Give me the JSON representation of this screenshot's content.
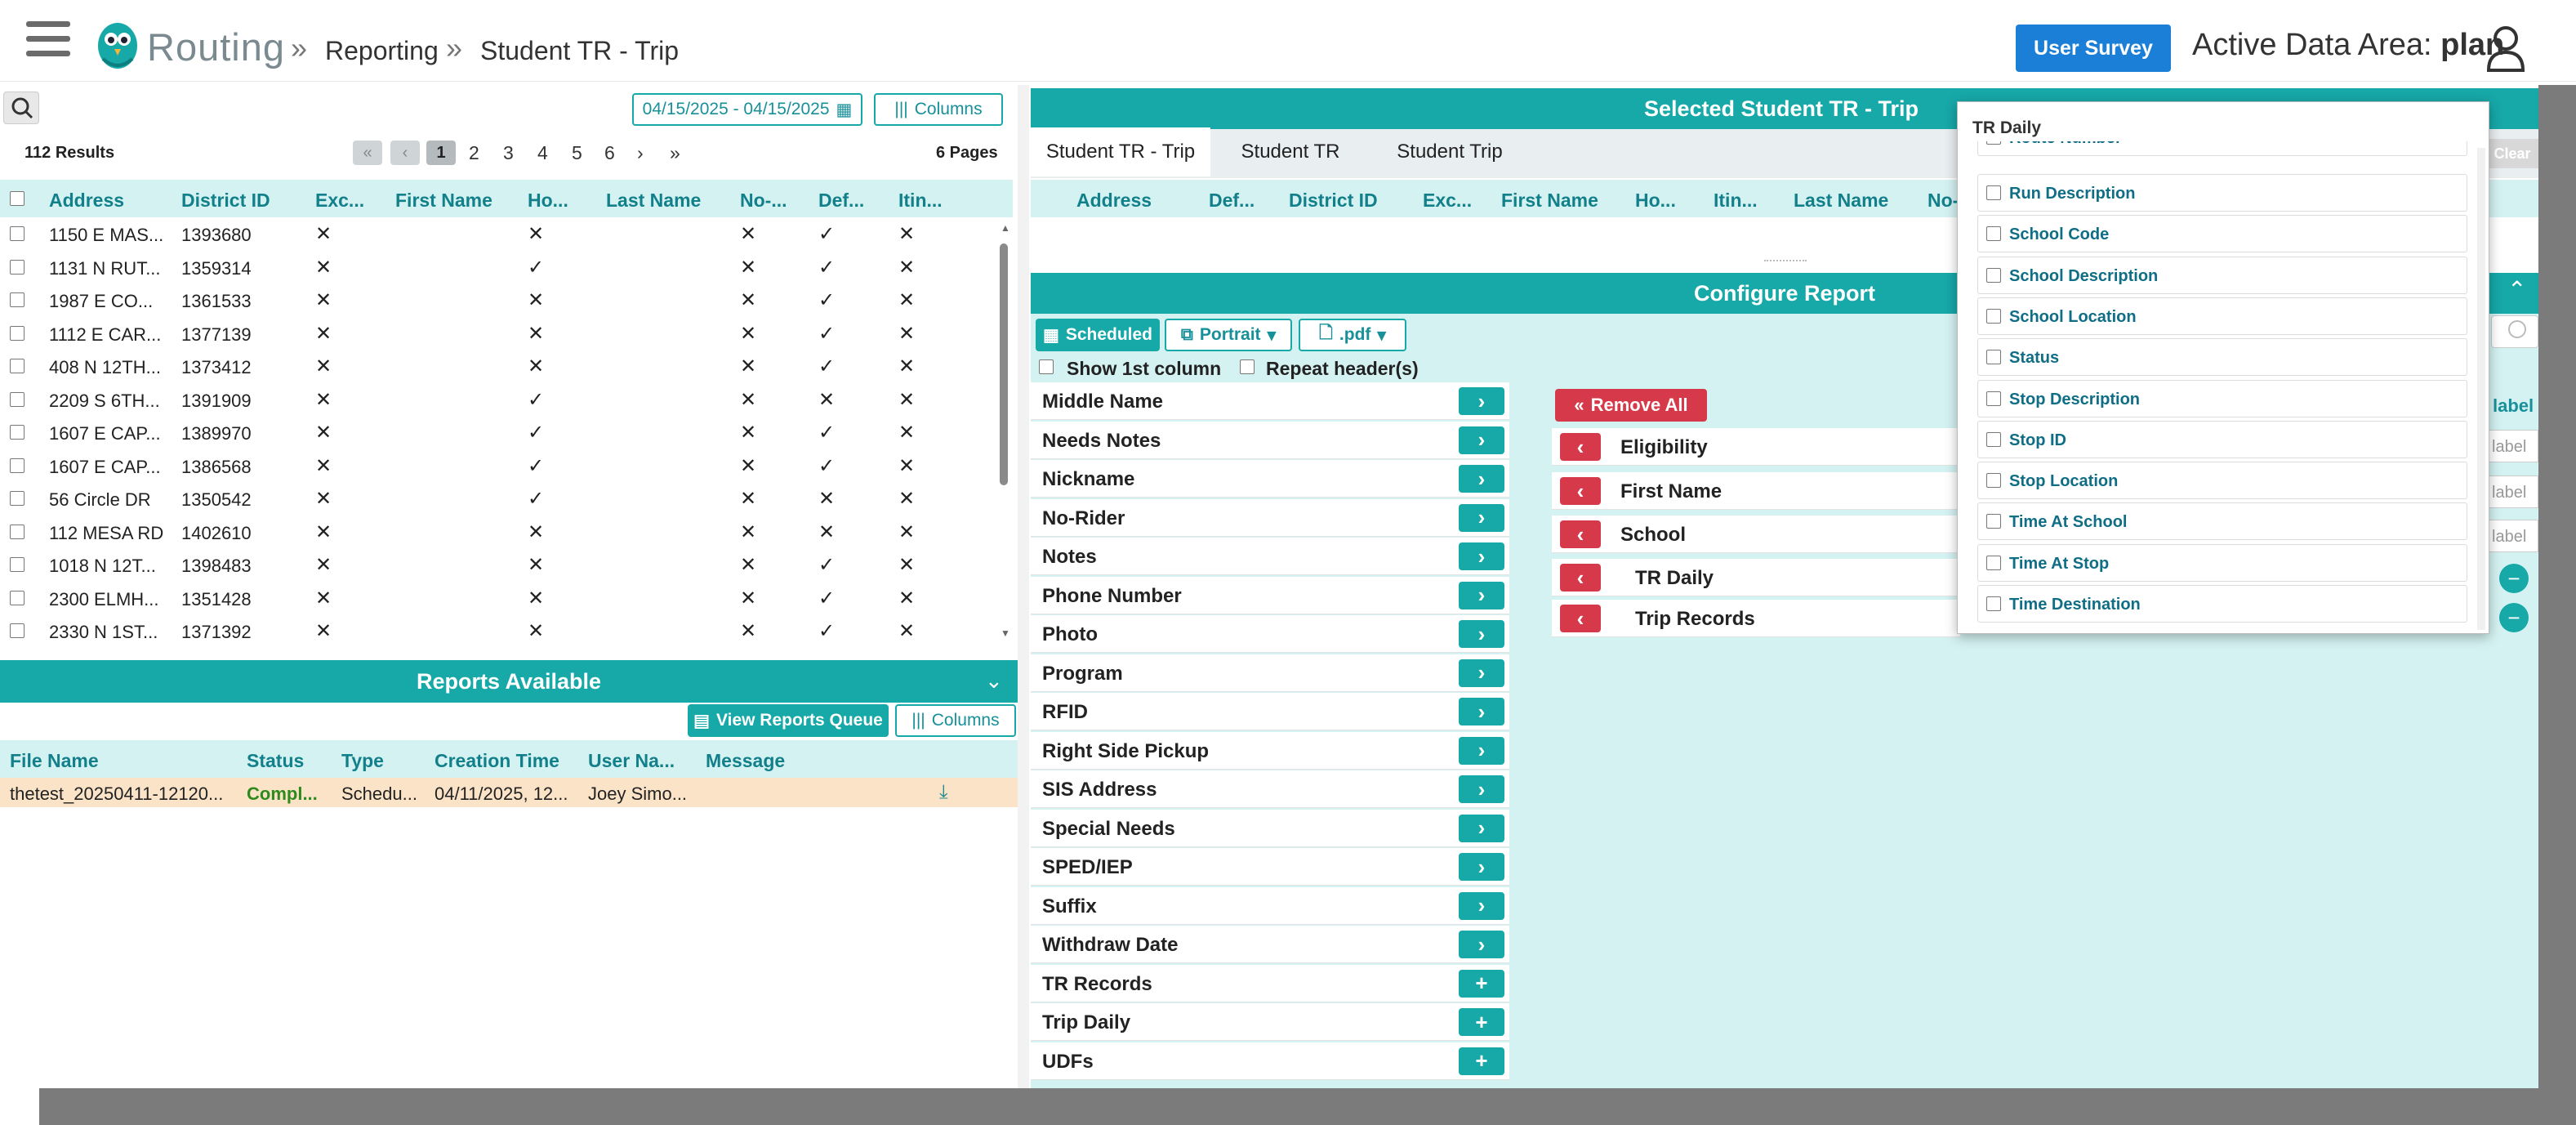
{
  "header": {
    "brand": "Routing",
    "sep": "»",
    "crumbs": [
      "Reporting",
      "Student TR - Trip"
    ],
    "survey_btn": "User Survey",
    "area_label": "Active Data Area:",
    "area_value": "plan"
  },
  "left": {
    "date_range": "04/15/2025 - 04/15/2025",
    "columns_btn": "Columns",
    "results": "112 Results",
    "pages": [
      "1",
      "2",
      "3",
      "4",
      "5",
      "6"
    ],
    "pages_total": "6 Pages",
    "headers": [
      "Address",
      "District ID",
      "Exc...",
      "First Name",
      "Ho...",
      "Last Name",
      "No-...",
      "Def...",
      "Itin..."
    ],
    "rows": [
      [
        "1150 E MAS...",
        "1393680",
        "✕",
        "",
        "✕",
        "",
        "✕",
        "✓",
        "✕"
      ],
      [
        "1131 N RUT...",
        "1359314",
        "✕",
        "",
        "✓",
        "",
        "✕",
        "✓",
        "✕"
      ],
      [
        "1987 E CO...",
        "1361533",
        "✕",
        "",
        "✕",
        "",
        "✕",
        "✓",
        "✕"
      ],
      [
        "1112 E CAR...",
        "1377139",
        "✕",
        "",
        "✕",
        "",
        "✕",
        "✓",
        "✕"
      ],
      [
        "408 N 12TH...",
        "1373412",
        "✕",
        "",
        "✕",
        "",
        "✕",
        "✓",
        "✕"
      ],
      [
        "2209 S 6TH...",
        "1391909",
        "✕",
        "",
        "✓",
        "",
        "✕",
        "✕",
        "✕"
      ],
      [
        "1607 E CAP...",
        "1389970",
        "✕",
        "",
        "✓",
        "",
        "✕",
        "✓",
        "✕"
      ],
      [
        "1607 E CAP...",
        "1386568",
        "✕",
        "",
        "✓",
        "",
        "✕",
        "✓",
        "✕"
      ],
      [
        "56 Circle DR",
        "1350542",
        "✕",
        "",
        "✓",
        "",
        "✕",
        "✕",
        "✕"
      ],
      [
        "112 MESA RD",
        "1402610",
        "✕",
        "",
        "✕",
        "",
        "✕",
        "✕",
        "✕"
      ],
      [
        "1018 N 12T...",
        "1398483",
        "✕",
        "",
        "✕",
        "",
        "✕",
        "✓",
        "✕"
      ],
      [
        "2300 ELMH...",
        "1351428",
        "✕",
        "",
        "✕",
        "",
        "✕",
        "✓",
        "✕"
      ],
      [
        "2330 N 1ST...",
        "1371392",
        "✕",
        "",
        "✕",
        "",
        "✕",
        "✓",
        "✕"
      ]
    ]
  },
  "reports": {
    "title": "Reports Available",
    "view_queue": "View Reports Queue",
    "columns_btn": "Columns",
    "headers": [
      "File Name",
      "Status",
      "Type",
      "Creation Time",
      "User Na...",
      "Message"
    ],
    "row": [
      "thetest_20250411-12120...",
      "Compl...",
      "Schedu...",
      "04/11/2025, 12...",
      "Joey Simo...",
      ""
    ]
  },
  "selected": {
    "title": "Selected Student TR - Trip",
    "tabs": [
      "Student TR - Trip",
      "Student TR",
      "Student Trip"
    ],
    "headers": [
      "Address",
      "Def...",
      "District ID",
      "Exc...",
      "First Name",
      "Ho...",
      "Itin...",
      "Last Name",
      "No-"
    ],
    "clear": "Clear"
  },
  "configure": {
    "title": "Configure Report",
    "scheduled": "Scheduled",
    "portrait": "Portrait",
    "pdf": ".pdf",
    "show_first": "Show 1st column",
    "repeat_header": "Repeat header(s)",
    "fields": [
      "Middle Name",
      "Needs Notes",
      "Nickname",
      "No-Rider",
      "Notes",
      "Phone Number",
      "Photo",
      "Program",
      "RFID",
      "Right Side Pickup",
      "SIS Address",
      "Special Needs",
      "SPED/IEP",
      "Suffix",
      "Withdraw Date"
    ],
    "groups": [
      "TR Records",
      "Trip Daily",
      "UDFs"
    ],
    "remove_all": "Remove All",
    "selected_fields": [
      "Eligibility",
      "First Name",
      "School",
      "TR Daily",
      "Trip Records"
    ],
    "label_hdr": "label",
    "label_ph": "label"
  },
  "dropdown": {
    "title": "TR Daily",
    "partial": "Route Number",
    "items": [
      "Run Description",
      "School Code",
      "School Description",
      "School Location",
      "Status",
      "Stop Description",
      "Stop ID",
      "Stop Location",
      "Time At School",
      "Time At Stop",
      "Time Destination"
    ]
  },
  "colors": {
    "teal": "#17a8a8",
    "red": "#d63a4a",
    "blue": "#1b7fd8",
    "light_teal": "#d5f2f2"
  }
}
